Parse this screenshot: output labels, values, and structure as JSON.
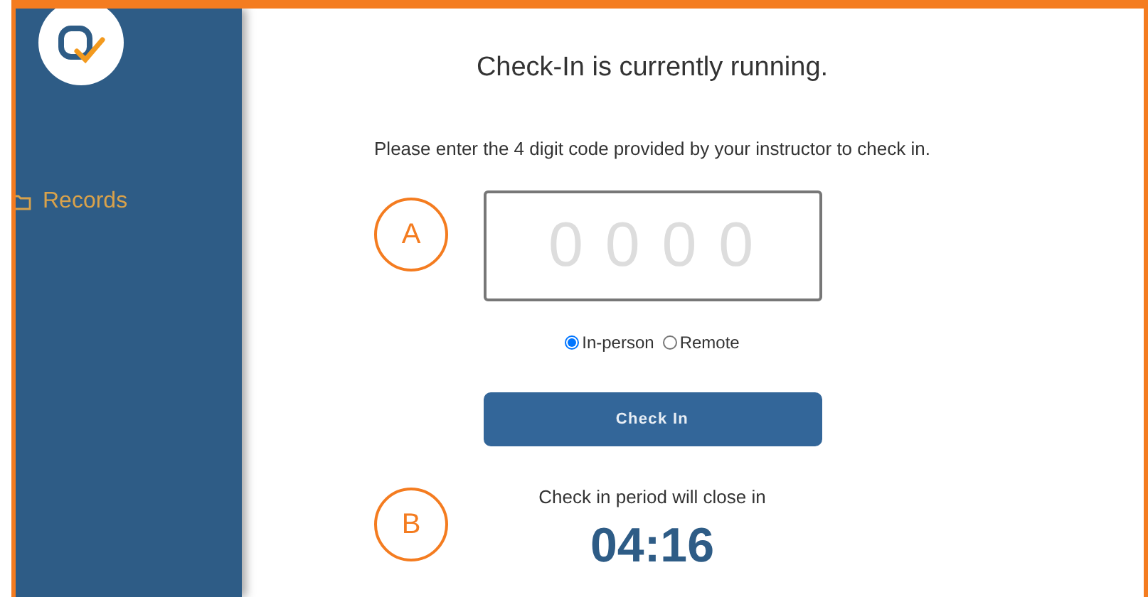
{
  "sidebar": {
    "items": [
      {
        "label": "Records"
      }
    ]
  },
  "checkin": {
    "title": "Check-In is currently running.",
    "instruction": "Please enter the 4 digit code provided by your instructor to check in.",
    "code": {
      "placeholder": "0000"
    },
    "modes": [
      {
        "label": "In-person",
        "selected": true
      },
      {
        "label": "Remote",
        "selected": false
      }
    ],
    "button": "Check In",
    "countdown_label": "Check in period will close in",
    "countdown": "04:16"
  },
  "markers": [
    {
      "label": "A"
    },
    {
      "label": "B"
    }
  ]
}
